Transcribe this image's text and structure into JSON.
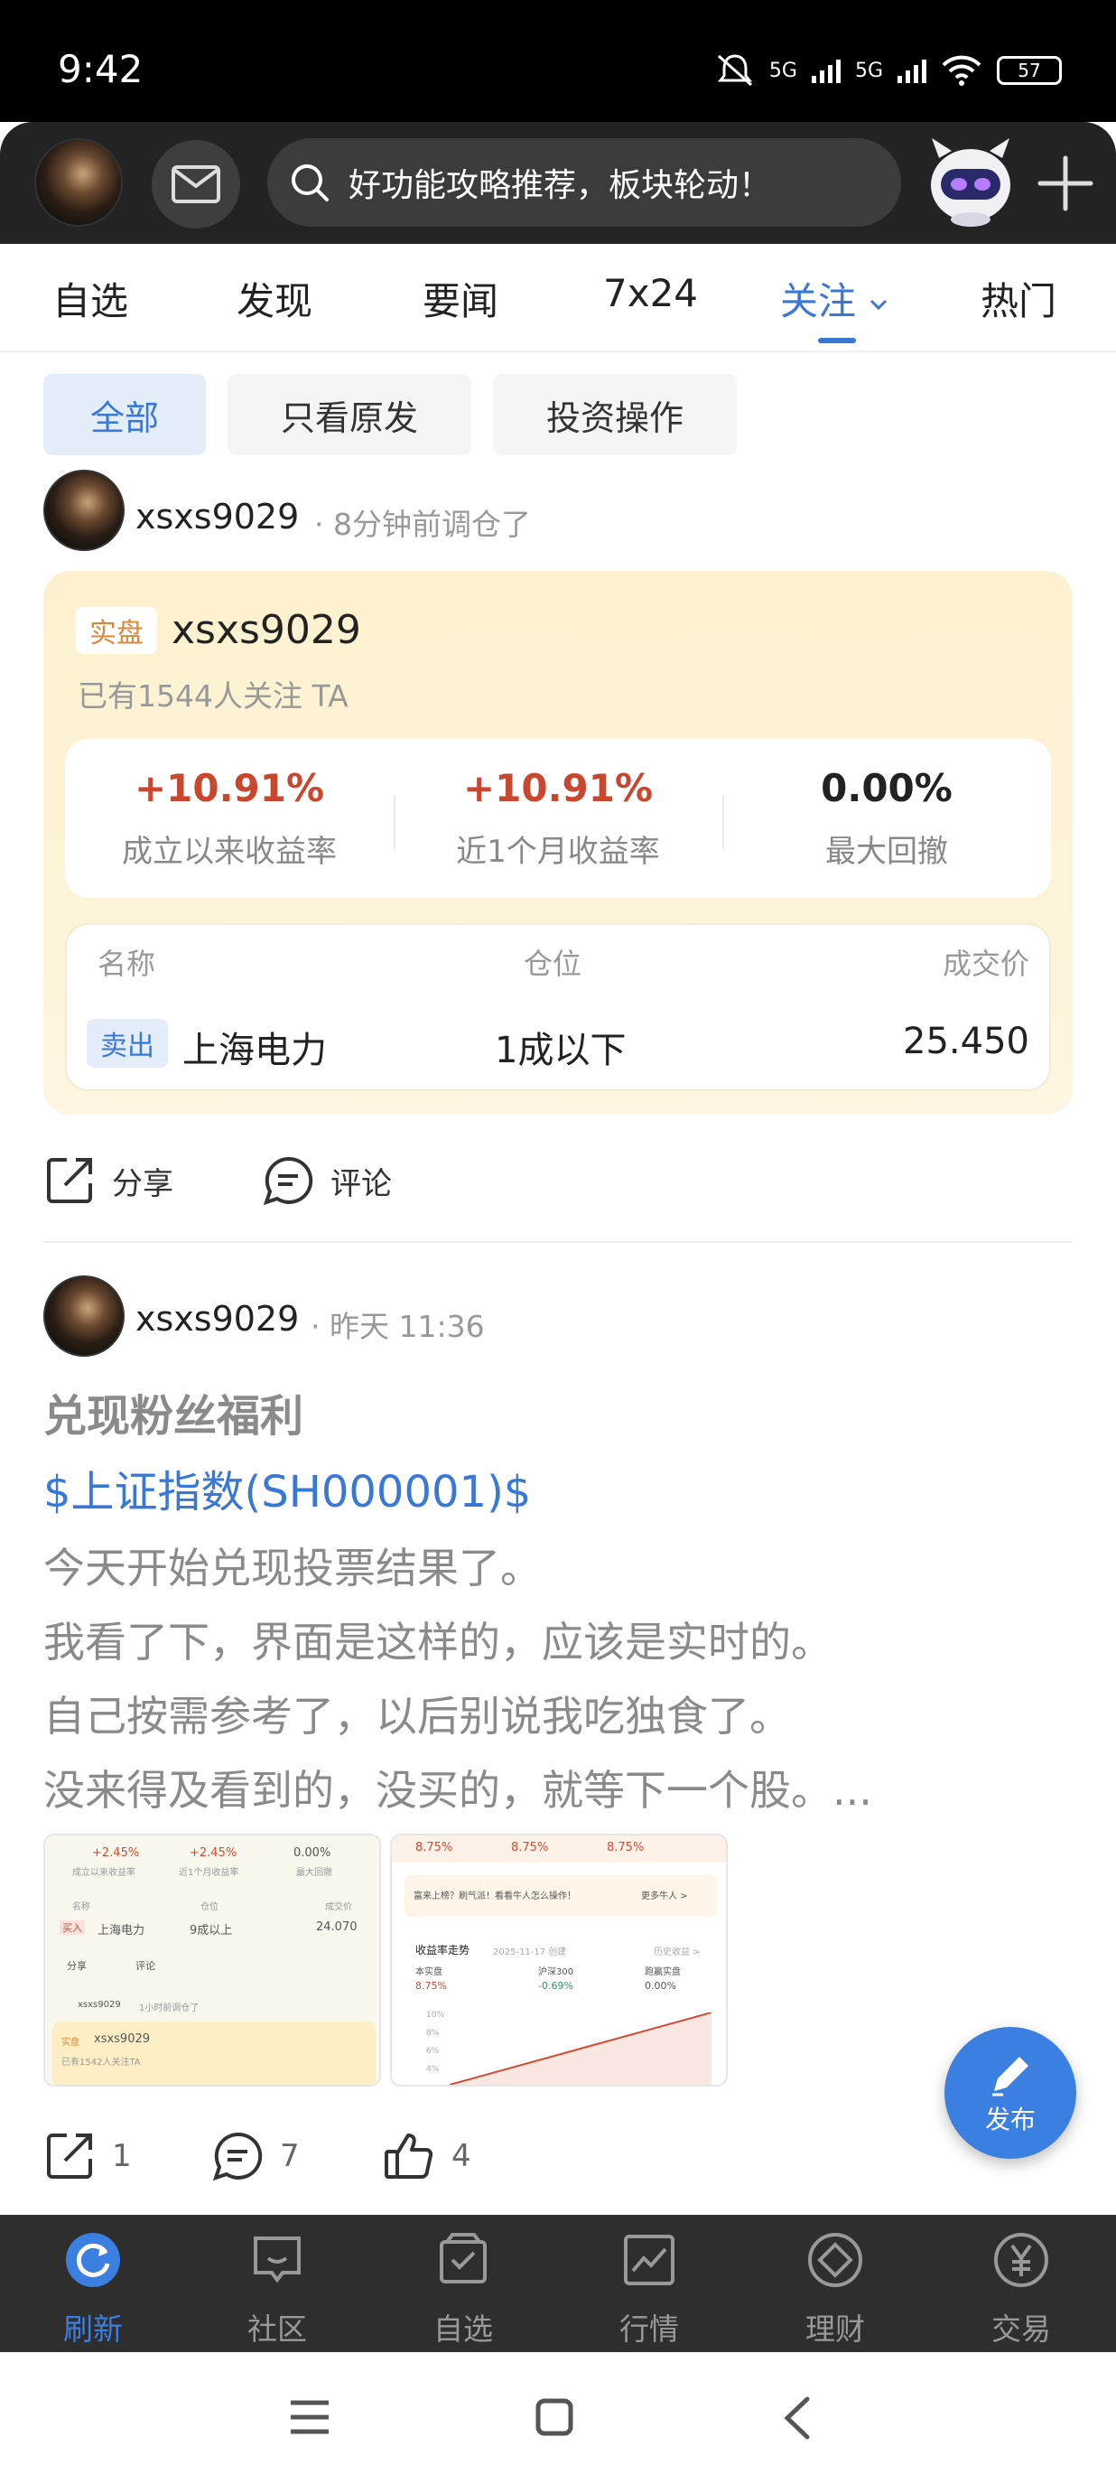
{
  "status_bar": {
    "time": "9:42",
    "network1": "5G",
    "network2": "5G",
    "battery": "57"
  },
  "header": {
    "search_placeholder": "好功能攻略推荐，板块轮动！"
  },
  "tabs": [
    {
      "label": "自选"
    },
    {
      "label": "发现"
    },
    {
      "label": "要闻"
    },
    {
      "label": "7x24"
    },
    {
      "label": "关注"
    },
    {
      "label": "热门"
    }
  ],
  "active_tab": "关注",
  "filters": [
    {
      "label": "全部"
    },
    {
      "label": "只看原发"
    },
    {
      "label": "投资操作"
    }
  ],
  "post1": {
    "username": "xsxs9029",
    "meta": "· 8分钟前调仓了",
    "card": {
      "badge": "实盘",
      "name": "xsxs9029",
      "followers": "已有1544人关注 TA",
      "stats": [
        {
          "value": "+10.91%",
          "label": "成立以来收益率"
        },
        {
          "value": "+10.91%",
          "label": "近1个月收益率"
        },
        {
          "value": "0.00%",
          "label": "最大回撤"
        }
      ],
      "table_headers": {
        "name": "名称",
        "position": "仓位",
        "price": "成交价"
      },
      "trade": {
        "action": "卖出",
        "stock": "上海电力",
        "position": "1成以下",
        "price": "25.450"
      }
    },
    "actions": {
      "share": "分享",
      "comment": "评论"
    }
  },
  "post2": {
    "username": "xsxs9029",
    "meta": "· 昨天 11:36",
    "title": "兑现粉丝福利",
    "link": "$上证指数(SH000001)$",
    "lines": [
      "今天开始兑现投票结果了。",
      "我看了下，界面是这样的，应该是实时的。",
      "自己按需参考了，以后别说我吃独食了。",
      "没来得及看到的，没买的，就等下一个股。..."
    ],
    "thumb1": {
      "v1": "+2.45%",
      "v2": "+2.45%",
      "v3": "0.00%",
      "l1": "成立以来收益率",
      "l2": "近1个月收益率",
      "l3": "最大回撤",
      "h1": "名称",
      "h2": "仓位",
      "h3": "成交价",
      "badge": "买入",
      "stock": "上海电力",
      "pos": "9成以上",
      "price": "24.070",
      "share": "分享",
      "comment": "评论",
      "user": "xsxs9029",
      "time": "1小时前调仓了",
      "tag": "实盘",
      "name": "xsxs9029",
      "follow": "已有1542人关注TA"
    },
    "thumb2": {
      "p1": "8.75%",
      "p2": "8.75%",
      "p3": "8.75%",
      "banner": "富来上榜？刷气派！看看牛人怎么操作！",
      "more": "更多牛人 >",
      "trend": "收益率走势",
      "date": "2025-11-17 创建",
      "hist": "历史收益 >",
      "s1": "本实盘",
      "s2": "沪深300",
      "s3": "跑赢实盘",
      "s1v": "8.75%",
      "s2v": "-0.69%",
      "s3v": "0.00%",
      "y1": "10%",
      "y2": "8%",
      "y3": "6%",
      "y4": "4%"
    },
    "counts": {
      "share": "1",
      "comment": "7",
      "like": "4"
    }
  },
  "fab": {
    "label": "发布"
  },
  "bottom_nav": [
    {
      "label": "刷新"
    },
    {
      "label": "社区"
    },
    {
      "label": "自选"
    },
    {
      "label": "行情"
    },
    {
      "label": "理财"
    },
    {
      "label": "交易"
    }
  ],
  "colors": {
    "accent": "#3a78d6",
    "gain": "#c9472f",
    "card_bg": "#fdf1cf",
    "nav_bg": "#2e2e2e"
  }
}
